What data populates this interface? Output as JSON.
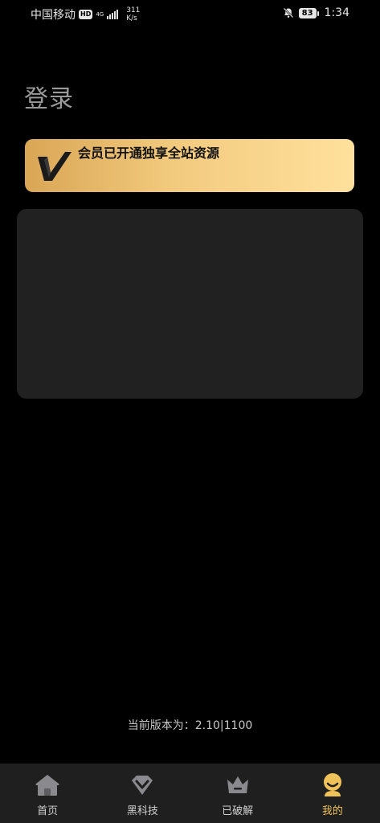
{
  "status_bar": {
    "carrier": "中国移动",
    "hd": "HD",
    "network": "4G",
    "speed_value": "311",
    "speed_unit": "K/s",
    "battery": "83",
    "time": "1:34"
  },
  "page": {
    "title": "登录"
  },
  "vip_banner": {
    "text": "会员已开通独享全站资源"
  },
  "footer": {
    "version_label": "当前版本为：",
    "version_value": "2.10|1100"
  },
  "nav": {
    "items": [
      {
        "label": "首页",
        "icon": "home-icon"
      },
      {
        "label": "黑科技",
        "icon": "diamond-icon"
      },
      {
        "label": "已破解",
        "icon": "crown-icon"
      },
      {
        "label": "我的",
        "icon": "profile-icon"
      }
    ],
    "active_index": 3
  },
  "colors": {
    "background": "#000000",
    "card": "#212121",
    "nav_bar": "#1f1f1f",
    "accent": "#f0c25a",
    "gold_start": "#d9a655",
    "gold_end": "#ffe19d"
  }
}
